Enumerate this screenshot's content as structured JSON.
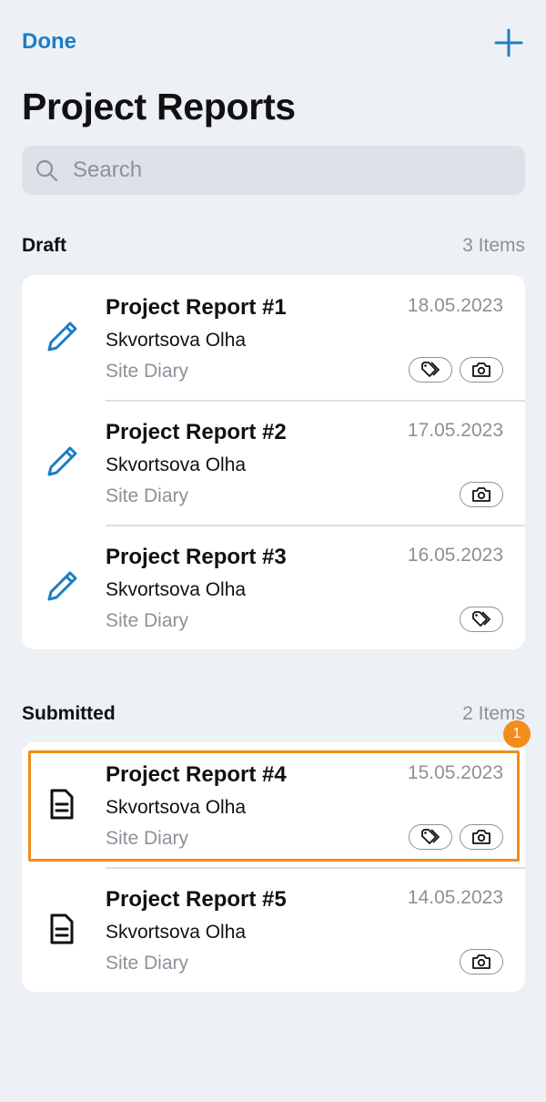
{
  "header": {
    "done_label": "Done",
    "add_icon": "plus-icon",
    "title": "Project Reports"
  },
  "search": {
    "placeholder": "Search",
    "value": ""
  },
  "sections": [
    {
      "label": "Draft",
      "count": "3 Items",
      "items": [
        {
          "title": "Project Report #1",
          "author": "Skvortsova Olha",
          "type": "Site Diary",
          "date": "18.05.2023",
          "icon": "pencil-icon",
          "tags": [
            "tag",
            "camera"
          ]
        },
        {
          "title": "Project Report #2",
          "author": "Skvortsova Olha",
          "type": "Site Diary",
          "date": "17.05.2023",
          "icon": "pencil-icon",
          "tags": [
            "camera"
          ]
        },
        {
          "title": "Project Report #3",
          "author": "Skvortsova Olha",
          "type": "Site Diary",
          "date": "16.05.2023",
          "icon": "pencil-icon",
          "tags": [
            "tag"
          ]
        }
      ]
    },
    {
      "label": "Submitted",
      "count": "2 Items",
      "items": [
        {
          "title": "Project Report #4",
          "author": "Skvortsova Olha",
          "type": "Site Diary",
          "date": "15.05.2023",
          "icon": "document-icon",
          "tags": [
            "tag",
            "camera"
          ]
        },
        {
          "title": "Project Report #5",
          "author": "Skvortsova Olha",
          "type": "Site Diary",
          "date": "14.05.2023",
          "icon": "document-icon",
          "tags": [
            "camera"
          ]
        }
      ]
    }
  ],
  "annotation": {
    "badge": "1"
  },
  "colors": {
    "accent": "#1a7fc4",
    "highlight": "#f28c1a",
    "background": "#edf1f5",
    "muted_text": "#8c9198"
  }
}
